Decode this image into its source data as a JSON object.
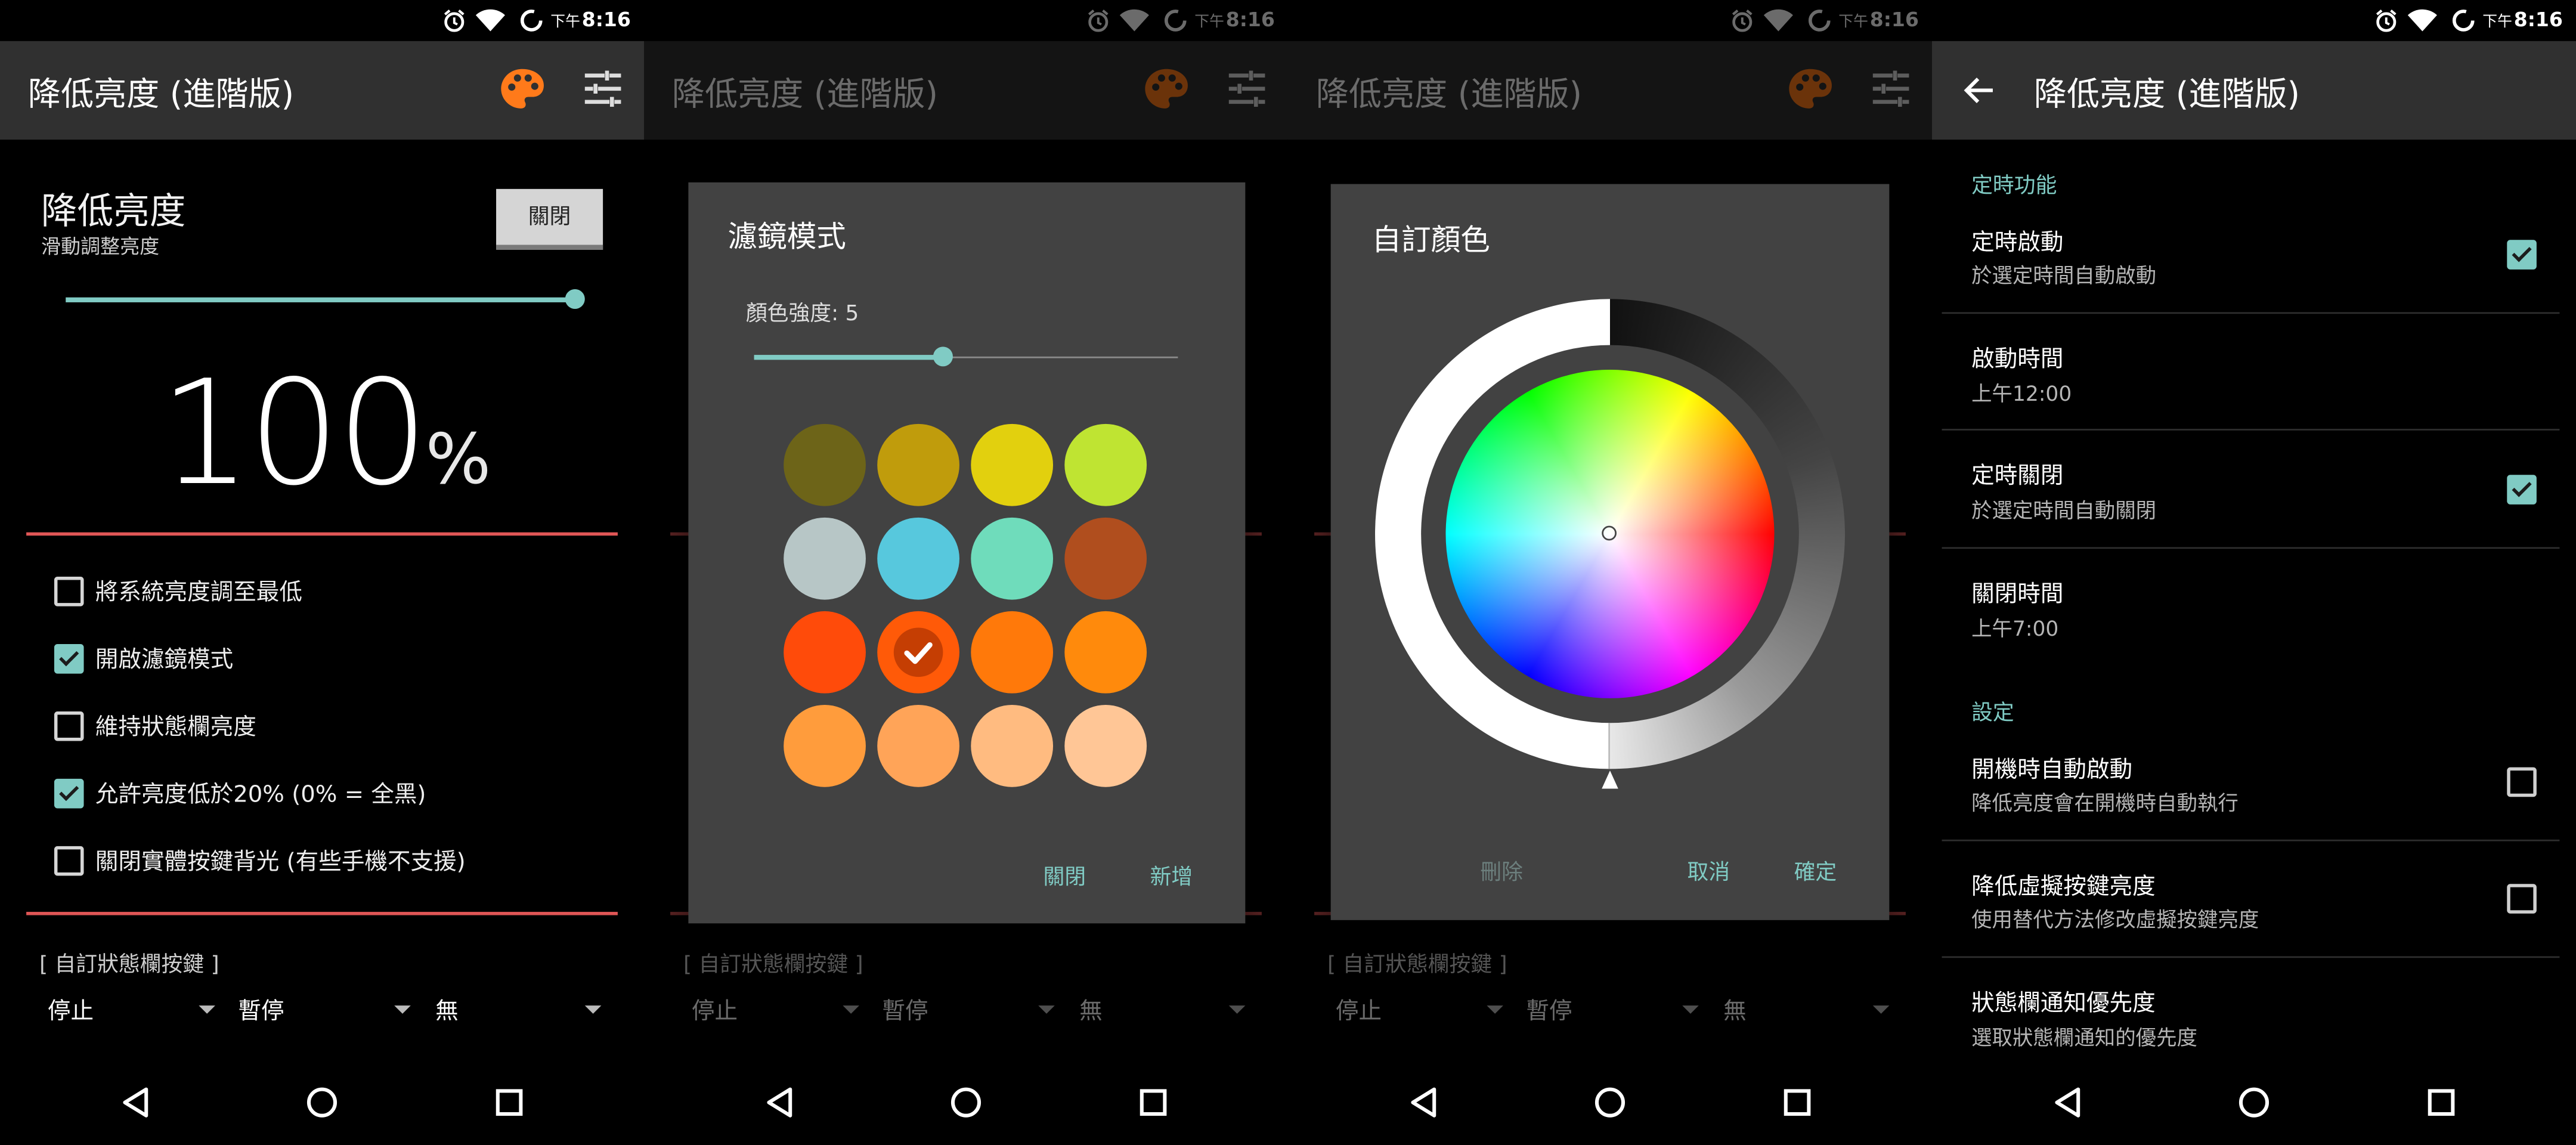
{
  "status": {
    "ampm": "下午",
    "time": "8:16"
  },
  "app_title": "降低亮度 (進階版)",
  "colors": {
    "accent": "#80cbc4",
    "toolbar": "#303030",
    "dialog": "#424242",
    "palette_icon": "#ff7a1a",
    "divider_red": "#e05656"
  },
  "main": {
    "title": "降低亮度",
    "subtitle": "滑動調整亮度",
    "toggle_label": "關閉",
    "brightness_slider_fraction": 0.98,
    "percent_value": "100",
    "percent_sign": "%",
    "options": [
      {
        "label": "將系統亮度調至最低",
        "checked": false
      },
      {
        "label": "開啟濾鏡模式",
        "checked": true
      },
      {
        "label": "維持狀態欄亮度",
        "checked": false
      },
      {
        "label": "允許亮度低於20% (0% = 全黑)",
        "checked": true
      },
      {
        "label": "關閉實體按鍵背光 (有些手機不支援)",
        "checked": false
      }
    ],
    "custom_keys_label": "[ 自訂狀態欄按鍵 ]",
    "spinners": [
      "停止",
      "暫停",
      "無"
    ]
  },
  "filter_dialog": {
    "title": "濾鏡模式",
    "intensity_label": "顏色強度: 5",
    "intensity_fraction": 0.45,
    "swatches": [
      "#6d6418",
      "#c09c0c",
      "#e2d00e",
      "#bfe432",
      "#b7c6c6",
      "#57c8dd",
      "#6fdcbb",
      "#b04e1e",
      "#ff4b0a",
      "#ff5a08",
      "#ff790a",
      "#ff8a0c",
      "#ff9c3c",
      "#ffa458",
      "#ffbb80",
      "#ffc696"
    ],
    "selected_index": 9,
    "close_label": "關閉",
    "add_label": "新增"
  },
  "color_dialog": {
    "title": "自訂顏色",
    "delete_label": "刪除",
    "cancel_label": "取消",
    "ok_label": "確定"
  },
  "settings": {
    "categories": [
      "定時功能",
      "設定"
    ],
    "items": [
      {
        "title": "定時啟動",
        "summary": "於選定時間自動啟動",
        "checkbox": true,
        "checked": true
      },
      {
        "title": "啟動時間",
        "summary": "上午12:00",
        "checkbox": false
      },
      {
        "title": "定時關閉",
        "summary": "於選定時間自動關閉",
        "checkbox": true,
        "checked": true
      },
      {
        "title": "關閉時間",
        "summary": "上午7:00",
        "checkbox": false
      },
      {
        "title": "開機時自動啟動",
        "summary": "降低亮度會在開機時自動執行",
        "checkbox": true,
        "checked": false
      },
      {
        "title": "降低虛擬按鍵亮度",
        "summary": "使用替代方法修改虛擬按鍵亮度",
        "checkbox": true,
        "checked": false
      },
      {
        "title": "狀態欄通知優先度",
        "summary": "選取狀態欄通知的優先度",
        "checkbox": false
      }
    ]
  }
}
